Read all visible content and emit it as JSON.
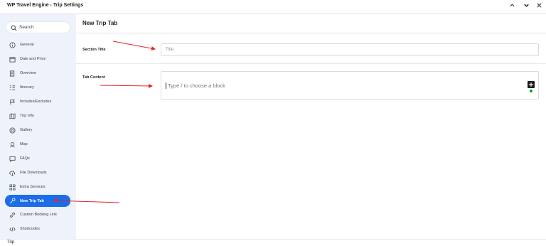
{
  "window": {
    "title": "WP Travel Engine - Trip Settings",
    "controls": [
      "chevron-up-icon",
      "chevron-up-icon",
      "chevron-down-icon",
      "close-icon"
    ]
  },
  "search": {
    "placeholder": "Search"
  },
  "sidebar": {
    "items": [
      {
        "label": "General",
        "icon": "info-icon"
      },
      {
        "label": "Date and Price",
        "icon": "calendar-icon"
      },
      {
        "label": "Overview",
        "icon": "document-icon"
      },
      {
        "label": "Itinerary",
        "icon": "itinerary-icon"
      },
      {
        "label": "Includes/Excludes",
        "icon": "flag-icon"
      },
      {
        "label": "Trip Info",
        "icon": "map-book-icon"
      },
      {
        "label": "Gallery",
        "icon": "gallery-icon"
      },
      {
        "label": "Map",
        "icon": "map-pin-icon"
      },
      {
        "label": "FAQs",
        "icon": "faq-icon"
      },
      {
        "label": "File Downloads",
        "icon": "cloud-download-icon"
      },
      {
        "label": "Extra Services",
        "icon": "grid-icon"
      },
      {
        "label": "New Trip Tab",
        "icon": "key-icon",
        "active": true
      },
      {
        "label": "Custom Booking Link",
        "icon": "link-icon"
      },
      {
        "label": "Shortcodes",
        "icon": "code-icon"
      }
    ]
  },
  "main": {
    "title": "New Trip Tab",
    "section_title": {
      "label": "Section Title",
      "placeholder": "Title"
    },
    "tab_content": {
      "label": "Tab Content",
      "placeholder": "Type / to choose a block"
    }
  },
  "status_bar": {
    "text": "Trip"
  },
  "colors": {
    "accent": "#1b6ee8",
    "sidebar_bg": "#eef3fb",
    "annotation_arrow": "#e0242b"
  }
}
